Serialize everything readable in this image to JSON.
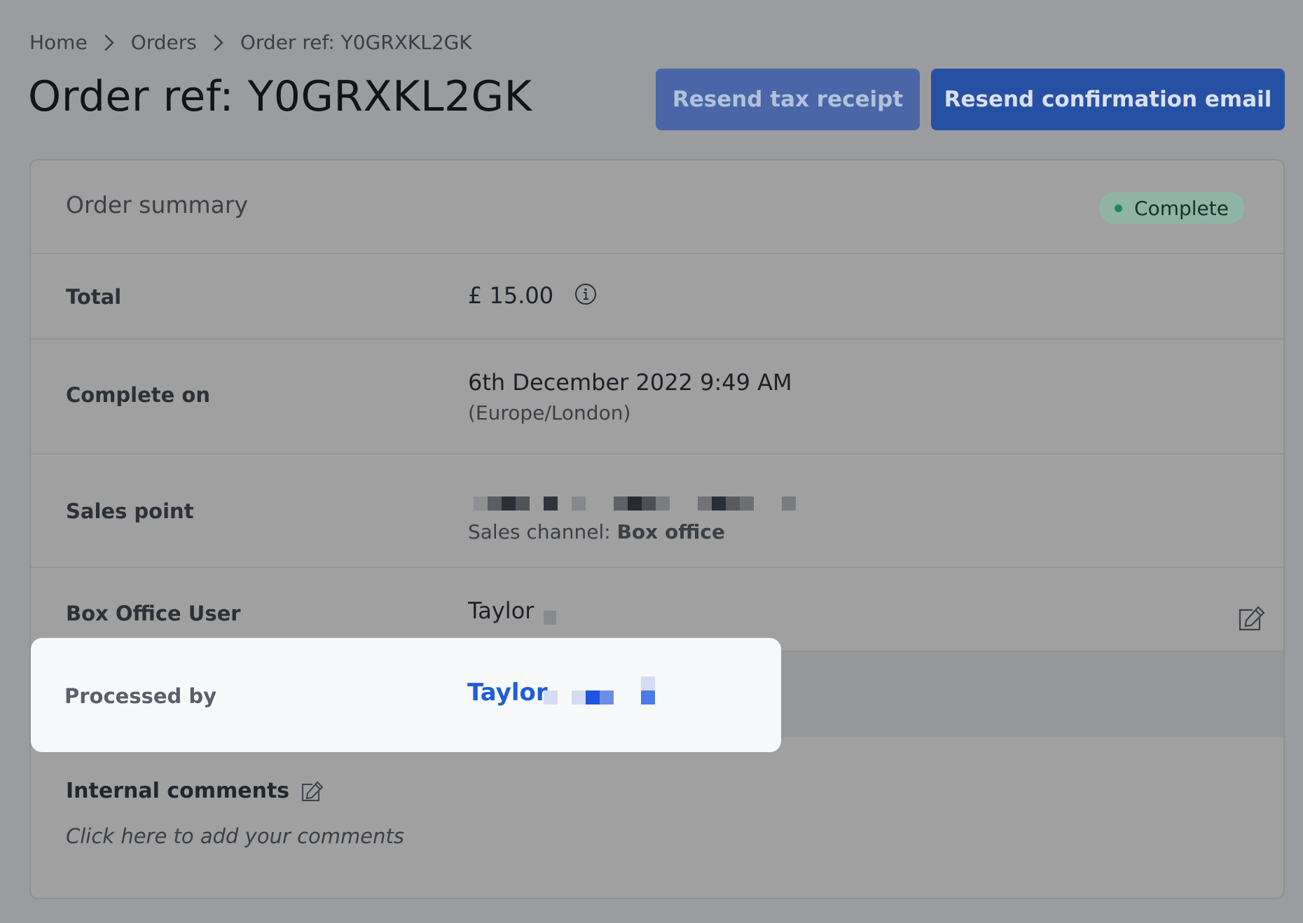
{
  "breadcrumb": {
    "items": [
      "Home",
      "Orders",
      "Order ref: Y0GRXKL2GK"
    ]
  },
  "page": {
    "title": "Order ref: Y0GRXKL2GK"
  },
  "actions": {
    "resend_tax_receipt": "Resend tax receipt",
    "resend_confirmation_email": "Resend confirmation email"
  },
  "summary": {
    "title": "Order summary",
    "status": "Complete",
    "rows": {
      "total": {
        "label": "Total",
        "value": "£ 15.00"
      },
      "complete_on": {
        "label": "Complete on",
        "value": "6th December 2022 9:49 AM",
        "timezone": "(Europe/London)"
      },
      "sales_point": {
        "label": "Sales point",
        "channel_prefix": "Sales channel: ",
        "channel": "Box office"
      },
      "box_office_user": {
        "label": "Box Office User",
        "value": "Taylor"
      },
      "processed_by": {
        "label": "Processed by",
        "value": "Taylor"
      }
    },
    "comments": {
      "title": "Internal comments",
      "placeholder": "Click here to add your comments"
    }
  },
  "colors": {
    "primary_button": "#2650a3",
    "link": "#1f5ed8",
    "status_dot": "#1e8a5c"
  },
  "icons": {
    "breadcrumb_separator": "chevron-right-icon",
    "total_info": "info-icon",
    "edit": "edit-icon"
  }
}
